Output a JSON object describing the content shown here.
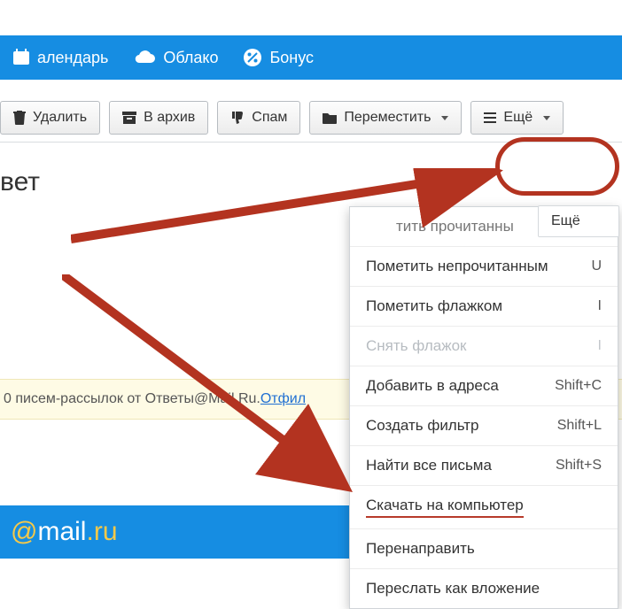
{
  "topnav": {
    "calendar": "алендарь",
    "cloud": "Облако",
    "bonus": "Бонус"
  },
  "toolbar": {
    "delete": "Удалить",
    "archive": "В архив",
    "spam": "Спам",
    "move": "Переместить",
    "more": "Ещё"
  },
  "more_tooltip": "Ещё",
  "subject": "вет",
  "info_band": {
    "text_prefix": "0 писем-рассылок от Ответы@Mail.Ru. ",
    "link": "Отфил"
  },
  "footer": {
    "at": "@",
    "mail": "mail",
    "dot": ".",
    "ru": "ru"
  },
  "dropdown": {
    "mark_read_partial": "тить прочитанны",
    "mark_unread": "Пометить непрочитанным",
    "mark_unread_k": "U",
    "flag": "Пометить флажком",
    "flag_k": "I",
    "unflag": "Снять флажок",
    "unflag_k": "I",
    "add_addr": "Добавить в адреса",
    "add_addr_k": "Shift+C",
    "filter": "Создать фильтр",
    "filter_k": "Shift+L",
    "find_all": "Найти все письма",
    "find_all_k": "Shift+S",
    "download": "Скачать на компьютер",
    "redirect": "Перенаправить",
    "forward": "Переслать как вложение"
  }
}
